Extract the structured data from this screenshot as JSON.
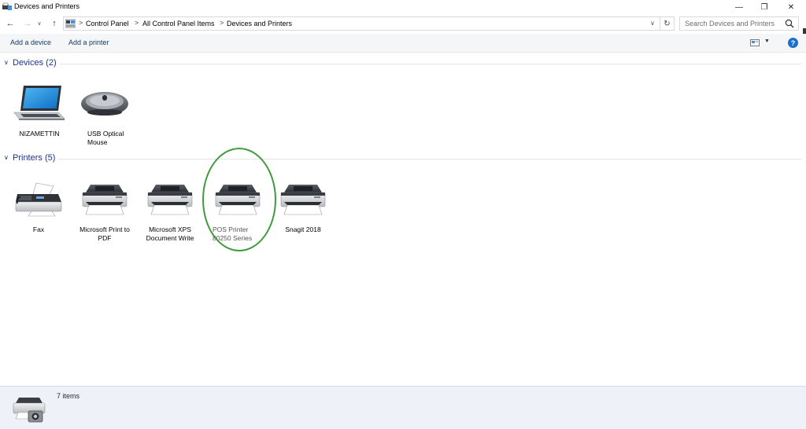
{
  "window": {
    "title": "Devices and Printers",
    "minimize_glyph": "—",
    "maximize_glyph": "❐",
    "close_glyph": "✕"
  },
  "nav": {
    "back_glyph": "←",
    "forward_glyph": "→",
    "recent_glyph": "∨",
    "up_glyph": "↑",
    "breadcrumb": [
      "Control Panel",
      "All Control Panel Items",
      "Devices and Printers"
    ],
    "separator": ">",
    "dropdown_glyph": "∨",
    "refresh_glyph": "↻",
    "search_placeholder": "Search Devices and Printers"
  },
  "commands": {
    "add_device": "Add a device",
    "add_printer": "Add a printer",
    "view_arrow": "▼",
    "help_glyph": "?"
  },
  "groups": {
    "devices": {
      "label": "Devices (2)",
      "chevron": "∨",
      "items": [
        {
          "name": "NIZAMETTIN",
          "icon": "laptop-icon"
        },
        {
          "name": "USB Optical Mouse",
          "icon": "mouse-icon"
        }
      ]
    },
    "printers": {
      "label": "Printers (5)",
      "chevron": "∨",
      "items": [
        {
          "name": "Fax",
          "icon": "fax-icon"
        },
        {
          "name": "Microsoft Print to PDF",
          "icon": "printer-icon"
        },
        {
          "name": "Microsoft XPS Document Write",
          "icon": "printer-icon"
        },
        {
          "name": "POS Printer 80250 Series",
          "icon": "printer-icon"
        },
        {
          "name": "Snagit 2018",
          "icon": "printer-icon"
        }
      ]
    }
  },
  "status": {
    "count": "7 items",
    "thumb_icon": "printer-camera-icon"
  },
  "colors": {
    "group_header": "#1e3287",
    "highlight": "#3f9a3c",
    "details_bg": "#eef2f8",
    "link": "#1a3a66"
  }
}
